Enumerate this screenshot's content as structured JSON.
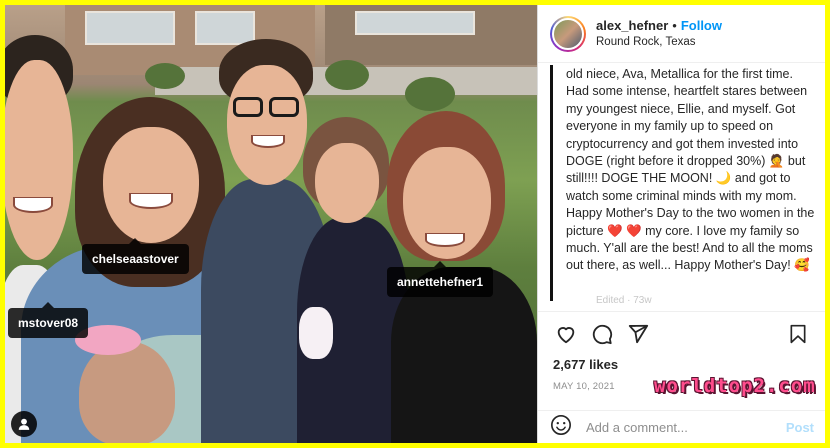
{
  "header": {
    "username": "alex_hefner",
    "separator": "•",
    "follow_label": "Follow",
    "location": "Round Rock, Texas"
  },
  "caption": {
    "text": "old niece, Ava, Metallica for the first time. Had some intense, heartfelt stares between my youngest niece, Ellie, and myself. Got everyone in my family up to speed on cryptocurrency and got them invested into DOGE (right before it dropped 30%) 🤦 but still!!!! DOGE THE MOON! 🌙 and got to watch some criminal minds with my mom. Happy Mother's Day to the two women in the picture ❤️ ❤️ my core. I love my family so much. Y'all are the best! And to all the moms out there, as well... Happy Mother's Day! 🥰",
    "edited": "Edited · 73w"
  },
  "tags": {
    "tag1": "chelseaastover",
    "tag2": "annettehefner1",
    "tag3": "mstover08"
  },
  "engagement": {
    "likes": "2,677 likes",
    "date": "MAY 10, 2021"
  },
  "comment": {
    "placeholder": "Add a comment...",
    "post_label": "Post"
  },
  "watermark": "worldtop2.com",
  "icons": {
    "like": "heart-icon",
    "comment": "comment-icon",
    "share": "share-icon",
    "save": "bookmark-icon",
    "emoji": "emoji-icon",
    "user_tags": "user-tag-icon"
  },
  "colors": {
    "frame": "#ffff00",
    "follow": "#0095f6",
    "post_disabled": "#b2dffc",
    "text": "#262626",
    "muted": "#8e8e8e"
  }
}
